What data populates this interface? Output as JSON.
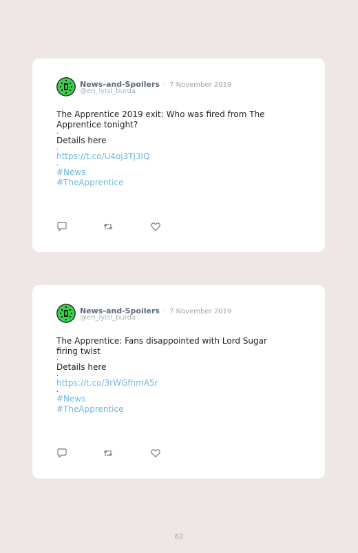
{
  "tweets": [
    {
      "display_name": "News-and-Spoilers",
      "separator": "·",
      "date": "7 November 2019",
      "handle": "@en_lyisi_burda",
      "text": "The Apprentice 2019 exit: Who was fired from The Apprentice tonight?",
      "sep1": ".",
      "details": "Details here",
      "sep2": ".",
      "link": "https://t.co/U4oj3Tj3IQ",
      "sep3": ".",
      "hashtags": [
        "#News",
        "#TheApprentice"
      ]
    },
    {
      "display_name": "News-and-Spoilers",
      "separator": "·",
      "date": "7 November 2019",
      "handle": "@en_lyisi_burda",
      "text": "The Apprentice: Fans disappointed with Lord Sugar firing twist",
      "sep1": ".",
      "details": "Details here",
      "sep2": ".",
      "link": "https://t.co/3rWGfhmA5r",
      "sep3": ".",
      "hashtags": [
        "#News",
        "#TheApprentice"
      ]
    }
  ],
  "icons": {
    "reply": "reply-icon",
    "retweet": "retweet-icon",
    "like": "like-icon",
    "avatar": "avatar-image"
  },
  "colors": {
    "background": "#efe6e6",
    "card": "#ffffff",
    "link": "#6cb8dd",
    "avatar_green": "#3ccf4e"
  },
  "page_number": "62"
}
